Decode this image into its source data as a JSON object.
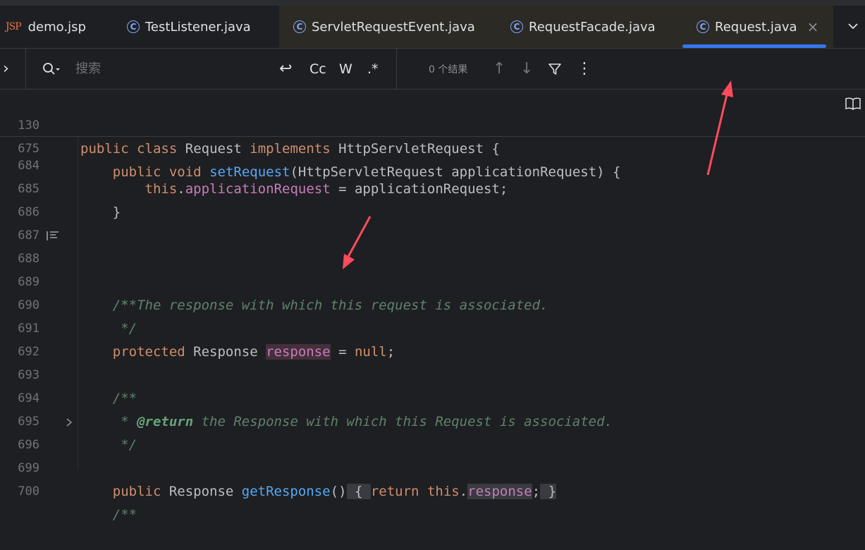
{
  "tabs": [
    {
      "label": "demo.jsp",
      "icon": "jsp-file-icon",
      "icon_text": "JSP"
    },
    {
      "label": "TestListener.java",
      "icon": "class-icon",
      "icon_text": "C"
    },
    {
      "label": "ServletRequestEvent.java",
      "icon": "class-icon",
      "icon_text": "C"
    },
    {
      "label": "RequestFacade.java",
      "icon": "class-icon",
      "icon_text": "C"
    },
    {
      "label": "Request.java",
      "icon": "class-icon",
      "icon_text": "C",
      "active": true,
      "close": "×"
    }
  ],
  "find": {
    "placeholder": "搜索",
    "expand": "›",
    "newline": "↩",
    "match_case": "Cc",
    "words": "W",
    "regex": ".*",
    "results": "0 个结果",
    "prev": "↑",
    "next": "↓",
    "more": "⋮"
  },
  "sticky": [
    {
      "ln": "130"
    },
    {
      "ln": "675"
    }
  ],
  "lines": [
    {
      "ln": "684"
    },
    {
      "ln": "685"
    },
    {
      "ln": "686"
    },
    {
      "ln": "687"
    },
    {
      "ln": "688"
    },
    {
      "ln": "689"
    },
    {
      "ln": "690"
    },
    {
      "ln": "691"
    },
    {
      "ln": "692"
    },
    {
      "ln": "693"
    },
    {
      "ln": "694"
    },
    {
      "ln": "695"
    },
    {
      "ln": "696"
    },
    {
      "ln": "699"
    },
    {
      "ln": "700"
    }
  ],
  "code": {
    "c130": {
      "kw1": "public",
      "kw2": "class",
      "t1": "Request",
      "kw3": "implements",
      "t2": "HttpServletRequest {"
    },
    "c675": {
      "kw1": "public",
      "kw2": "void",
      "fn": "setRequest",
      "t1": "(HttpServletRequest applicationRequest) {"
    },
    "c684": {
      "kw": "this",
      "dot": ".",
      "fld": "applicationRequest",
      "t1": " = applicationRequest;"
    },
    "c685": "}",
    "c688": "/**",
    "c689": " * The response with which this request is associated.",
    "c690": " */",
    "c691": {
      "kw1": "protected",
      "t1": " Response ",
      "fld": "response",
      "t2": " = ",
      "kw2": "null",
      "t3": ";"
    },
    "c693": "/**",
    "c694": {
      "star": " * ",
      "tag": "@return",
      "rest": " the Response with which this Request is associated."
    },
    "c695": " */",
    "c696": {
      "kw1": "public",
      "t1": " Response ",
      "fn": "getResponse",
      "t2": "()",
      "fold1": " { ",
      "kw2": "return",
      "t3": " ",
      "kw3": "this",
      "t4": ".",
      "fld": "response",
      "t5": ";",
      "fold2": " }"
    },
    "c700": "/**"
  },
  "colors": {
    "accent": "#3574f0",
    "annotation_arrow": "#ff4b5c"
  }
}
